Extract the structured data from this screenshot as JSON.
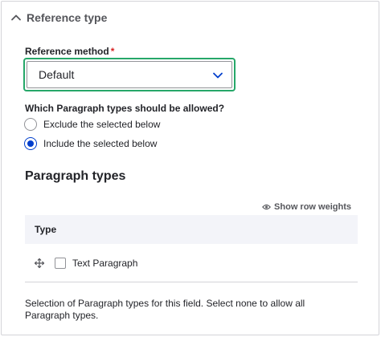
{
  "details": {
    "summary_label": "Reference type",
    "expanded": true
  },
  "reference_method": {
    "label": "Reference method",
    "required_marker": "*",
    "selected_value": "Default"
  },
  "allowed": {
    "label": "Which Paragraph types should be allowed?",
    "options": [
      {
        "label": "Exclude the selected below",
        "checked": false
      },
      {
        "label": "Include the selected below",
        "checked": true
      }
    ]
  },
  "paragraph_types": {
    "title": "Paragraph types",
    "show_row_weights_label": "Show row weights",
    "column_header": "Type",
    "rows": [
      {
        "label": "Text Paragraph",
        "checked": false
      }
    ],
    "description": "Selection of Paragraph types for this field. Select none to allow all Paragraph types."
  },
  "colors": {
    "focus_ring": "#26a769",
    "radio_checked": "#003ecc",
    "required": "#d72222",
    "table_header_bg": "#f3f4f9"
  },
  "icons": {
    "summary": "chevron-up-icon",
    "select": "chevron-down-icon",
    "row_weights": "eye-icon",
    "drag": "drag-handle-icon"
  }
}
